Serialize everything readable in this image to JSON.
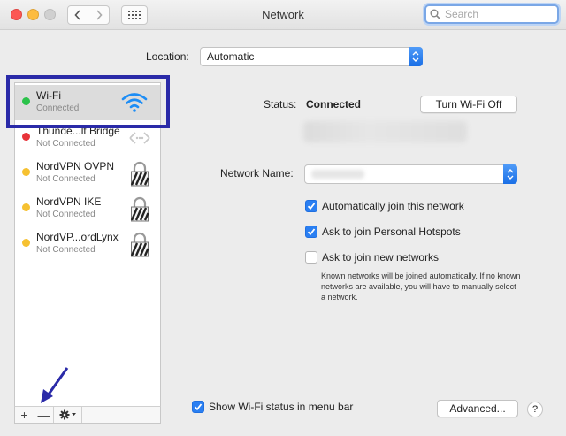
{
  "window": {
    "title": "Network"
  },
  "search": {
    "placeholder": "Search"
  },
  "location": {
    "label": "Location:",
    "value": "Automatic"
  },
  "sidebar": {
    "items": [
      {
        "name": "Wi-Fi",
        "status": "Connected",
        "dot_color": "#2bc24a",
        "icon": "wifi-icon"
      },
      {
        "name": "Thunde...lt Bridge",
        "status": "Not Connected",
        "dot_color": "#e8343a",
        "icon": "thunderbolt-bridge-icon"
      },
      {
        "name": "NordVPN OVPN",
        "status": "Not Connected",
        "dot_color": "#f6c131",
        "icon": "vpn-lock-icon"
      },
      {
        "name": "NordVPN IKE",
        "status": "Not Connected",
        "dot_color": "#f6c131",
        "icon": "vpn-lock-icon"
      },
      {
        "name": "NordVP...ordLynx",
        "status": "Not Connected",
        "dot_color": "#f6c131",
        "icon": "vpn-lock-icon"
      }
    ],
    "toolbar": {
      "add": "+",
      "remove": "—"
    }
  },
  "detail": {
    "status_label": "Status:",
    "status_value": "Connected",
    "turn_off_button": "Turn Wi-Fi Off",
    "network_name_label": "Network Name:",
    "checkboxes": [
      {
        "label": "Automatically join this network",
        "checked": true
      },
      {
        "label": "Ask to join Personal Hotspots",
        "checked": true
      },
      {
        "label": "Ask to join new networks",
        "checked": false
      }
    ],
    "hint": "Known networks will be joined automatically. If no known networks are available, you will have to manually select a network.",
    "show_status": {
      "label": "Show Wi-Fi status in menu bar",
      "checked": true
    },
    "advanced_button": "Advanced...",
    "help_button": "?"
  },
  "colors": {
    "accent": "#2a7ff2",
    "annotation": "#2a2aa8"
  }
}
